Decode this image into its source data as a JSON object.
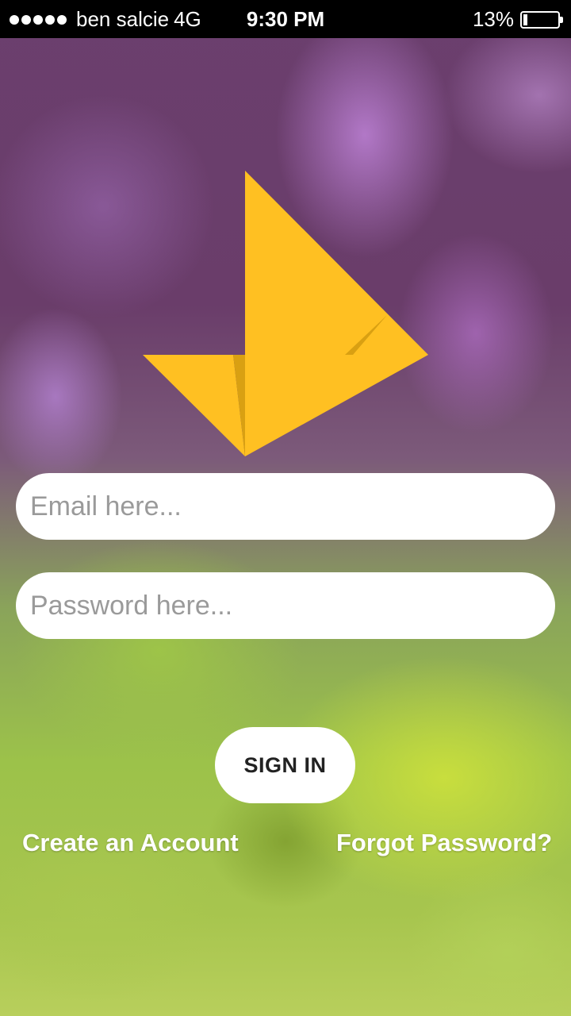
{
  "status_bar": {
    "carrier": "ben salcie",
    "network": "4G",
    "time": "9:30 PM",
    "battery_percent_text": "13%",
    "battery_level": 0.13
  },
  "logo": {
    "icon": "origami-bird-logo",
    "color": "#FFC022",
    "shade_color": "#D9A012"
  },
  "login_form": {
    "email_placeholder": "Email here...",
    "password_placeholder": "Password here...",
    "sign_in_label": "SIGN IN"
  },
  "links": {
    "create_account": "Create an Account",
    "forgot_password": "Forgot Password?"
  }
}
